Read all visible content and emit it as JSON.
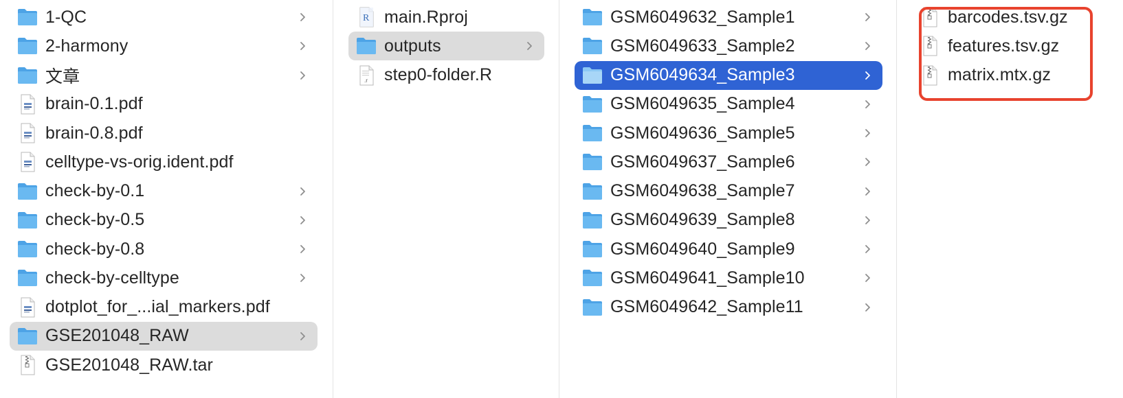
{
  "columns": [
    {
      "items": [
        {
          "label": "1-QC",
          "icon": "folder-icon",
          "chevron": true
        },
        {
          "label": "2-harmony",
          "icon": "folder-icon",
          "chevron": true
        },
        {
          "label": "文章",
          "icon": "folder-icon",
          "chevron": true
        },
        {
          "label": "brain-0.1.pdf",
          "icon": "pdf-file-icon",
          "chevron": false
        },
        {
          "label": "brain-0.8.pdf",
          "icon": "pdf-file-icon",
          "chevron": false
        },
        {
          "label": "celltype-vs-orig.ident.pdf",
          "icon": "pdf-file-icon",
          "chevron": false
        },
        {
          "label": "check-by-0.1",
          "icon": "folder-icon",
          "chevron": true
        },
        {
          "label": "check-by-0.5",
          "icon": "folder-icon",
          "chevron": true
        },
        {
          "label": "check-by-0.8",
          "icon": "folder-icon",
          "chevron": true
        },
        {
          "label": "check-by-celltype",
          "icon": "folder-icon",
          "chevron": true
        },
        {
          "label": "dotplot_for_...ial_markers.pdf",
          "icon": "pdf-file-icon",
          "chevron": false
        },
        {
          "label": "GSE201048_RAW",
          "icon": "folder-icon",
          "chevron": true,
          "state": "highlighted"
        },
        {
          "label": "GSE201048_RAW.tar",
          "icon": "archive-file-icon",
          "chevron": false
        }
      ]
    },
    {
      "items": [
        {
          "label": "main.Rproj",
          "icon": "rproj-file-icon",
          "chevron": false
        },
        {
          "label": "outputs",
          "icon": "folder-icon",
          "chevron": true,
          "state": "highlighted"
        },
        {
          "label": "step0-folder.R",
          "icon": "r-script-file-icon",
          "chevron": false
        }
      ]
    },
    {
      "items": [
        {
          "label": "GSM6049632_Sample1",
          "icon": "folder-icon",
          "chevron": true
        },
        {
          "label": "GSM6049633_Sample2",
          "icon": "folder-icon",
          "chevron": true
        },
        {
          "label": "GSM6049634_Sample3",
          "icon": "folder-icon",
          "chevron": true,
          "state": "selected"
        },
        {
          "label": "GSM6049635_Sample4",
          "icon": "folder-icon",
          "chevron": true
        },
        {
          "label": "GSM6049636_Sample5",
          "icon": "folder-icon",
          "chevron": true
        },
        {
          "label": "GSM6049637_Sample6",
          "icon": "folder-icon",
          "chevron": true
        },
        {
          "label": "GSM6049638_Sample7",
          "icon": "folder-icon",
          "chevron": true
        },
        {
          "label": "GSM6049639_Sample8",
          "icon": "folder-icon",
          "chevron": true
        },
        {
          "label": "GSM6049640_Sample9",
          "icon": "folder-icon",
          "chevron": true
        },
        {
          "label": "GSM6049641_Sample10",
          "icon": "folder-icon",
          "chevron": true
        },
        {
          "label": "GSM6049642_Sample11",
          "icon": "folder-icon",
          "chevron": true
        }
      ]
    },
    {
      "items": [
        {
          "label": "barcodes.tsv.gz",
          "icon": "archive-file-icon",
          "chevron": false
        },
        {
          "label": "features.tsv.gz",
          "icon": "archive-file-icon",
          "chevron": false
        },
        {
          "label": "matrix.mtx.gz",
          "icon": "archive-file-icon",
          "chevron": false
        }
      ]
    }
  ],
  "colors": {
    "selection": "#2f63d4",
    "highlight": "#dcdcdc",
    "folder": "#5fb2ee",
    "annotation_box": "#e8432e"
  }
}
